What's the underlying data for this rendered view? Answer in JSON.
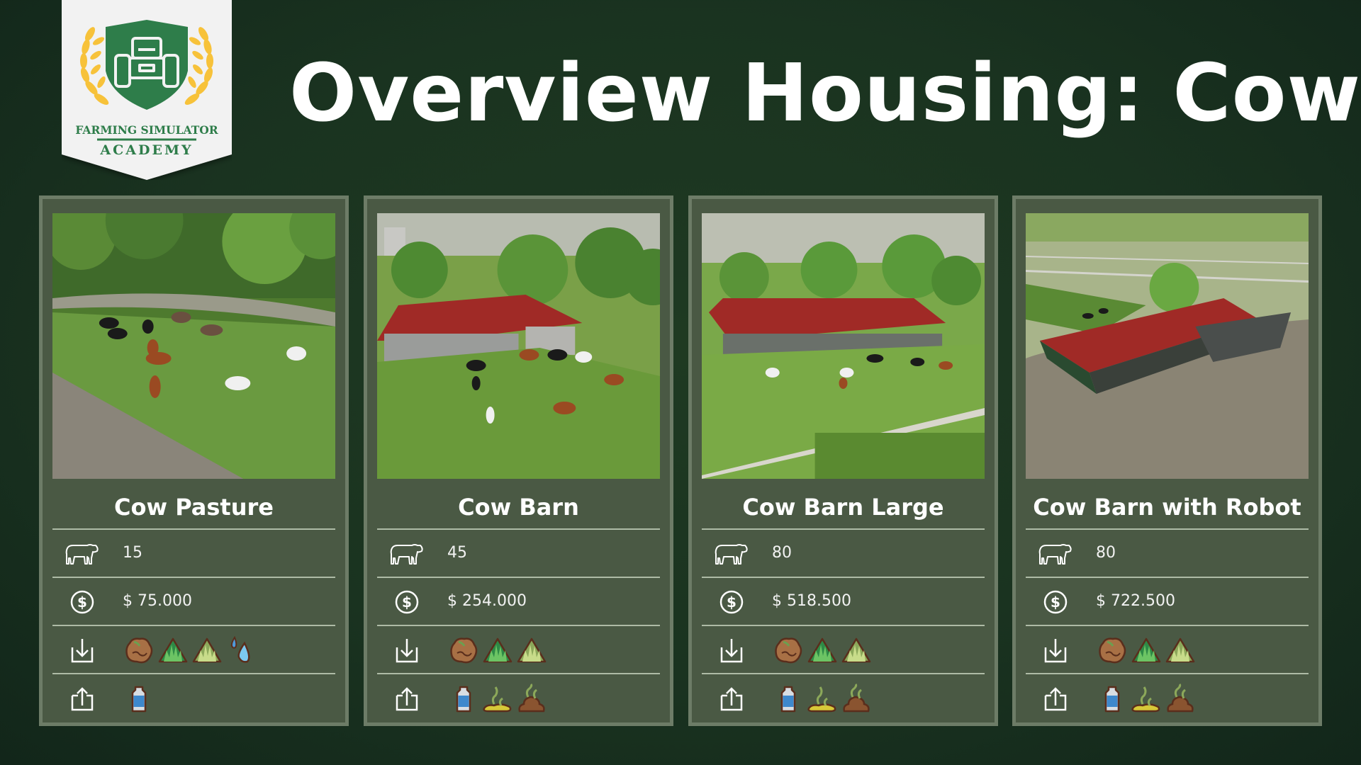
{
  "logo": {
    "line1": "FARMING SIMULATOR",
    "line2": "ACADEMY",
    "icon": "tractor-shield-icon",
    "colors": {
      "shield": "#2e7d4a",
      "wheat": "#f7c23a",
      "banner": "#f2f2f2"
    }
  },
  "title": "Overview Housing: Cows",
  "row_icons": {
    "capacity": "cow-icon",
    "price": "dollar-circle-icon",
    "input": "download-icon",
    "output": "upload-icon"
  },
  "cards": [
    {
      "name": "Cow Pasture",
      "image": "cow-pasture-scene",
      "capacity": "15",
      "price": "$ 75.000",
      "inputs": [
        "mixed-ration",
        "grass",
        "hay",
        "water"
      ],
      "outputs": [
        "milk"
      ]
    },
    {
      "name": "Cow Barn",
      "image": "cow-barn-scene",
      "capacity": "45",
      "price": "$ 254.000",
      "inputs": [
        "mixed-ration",
        "grass",
        "hay"
      ],
      "outputs": [
        "milk",
        "slurry",
        "manure"
      ]
    },
    {
      "name": "Cow Barn Large",
      "image": "cow-barn-large-scene",
      "capacity": "80",
      "price": "$ 518.500",
      "inputs": [
        "mixed-ration",
        "grass",
        "hay"
      ],
      "outputs": [
        "milk",
        "slurry",
        "manure"
      ]
    },
    {
      "name": "Cow Barn with Robot",
      "image": "cow-barn-robot-scene",
      "capacity": "80",
      "price": "$ 722.500",
      "inputs": [
        "mixed-ration",
        "grass",
        "hay"
      ],
      "outputs": [
        "milk",
        "slurry",
        "manure"
      ]
    }
  ],
  "colors": {
    "background": "#1a3320",
    "card": "#4a5944",
    "card_border": "#6d7c67",
    "divider": "#aebba6",
    "roof": "#9b2a26"
  }
}
